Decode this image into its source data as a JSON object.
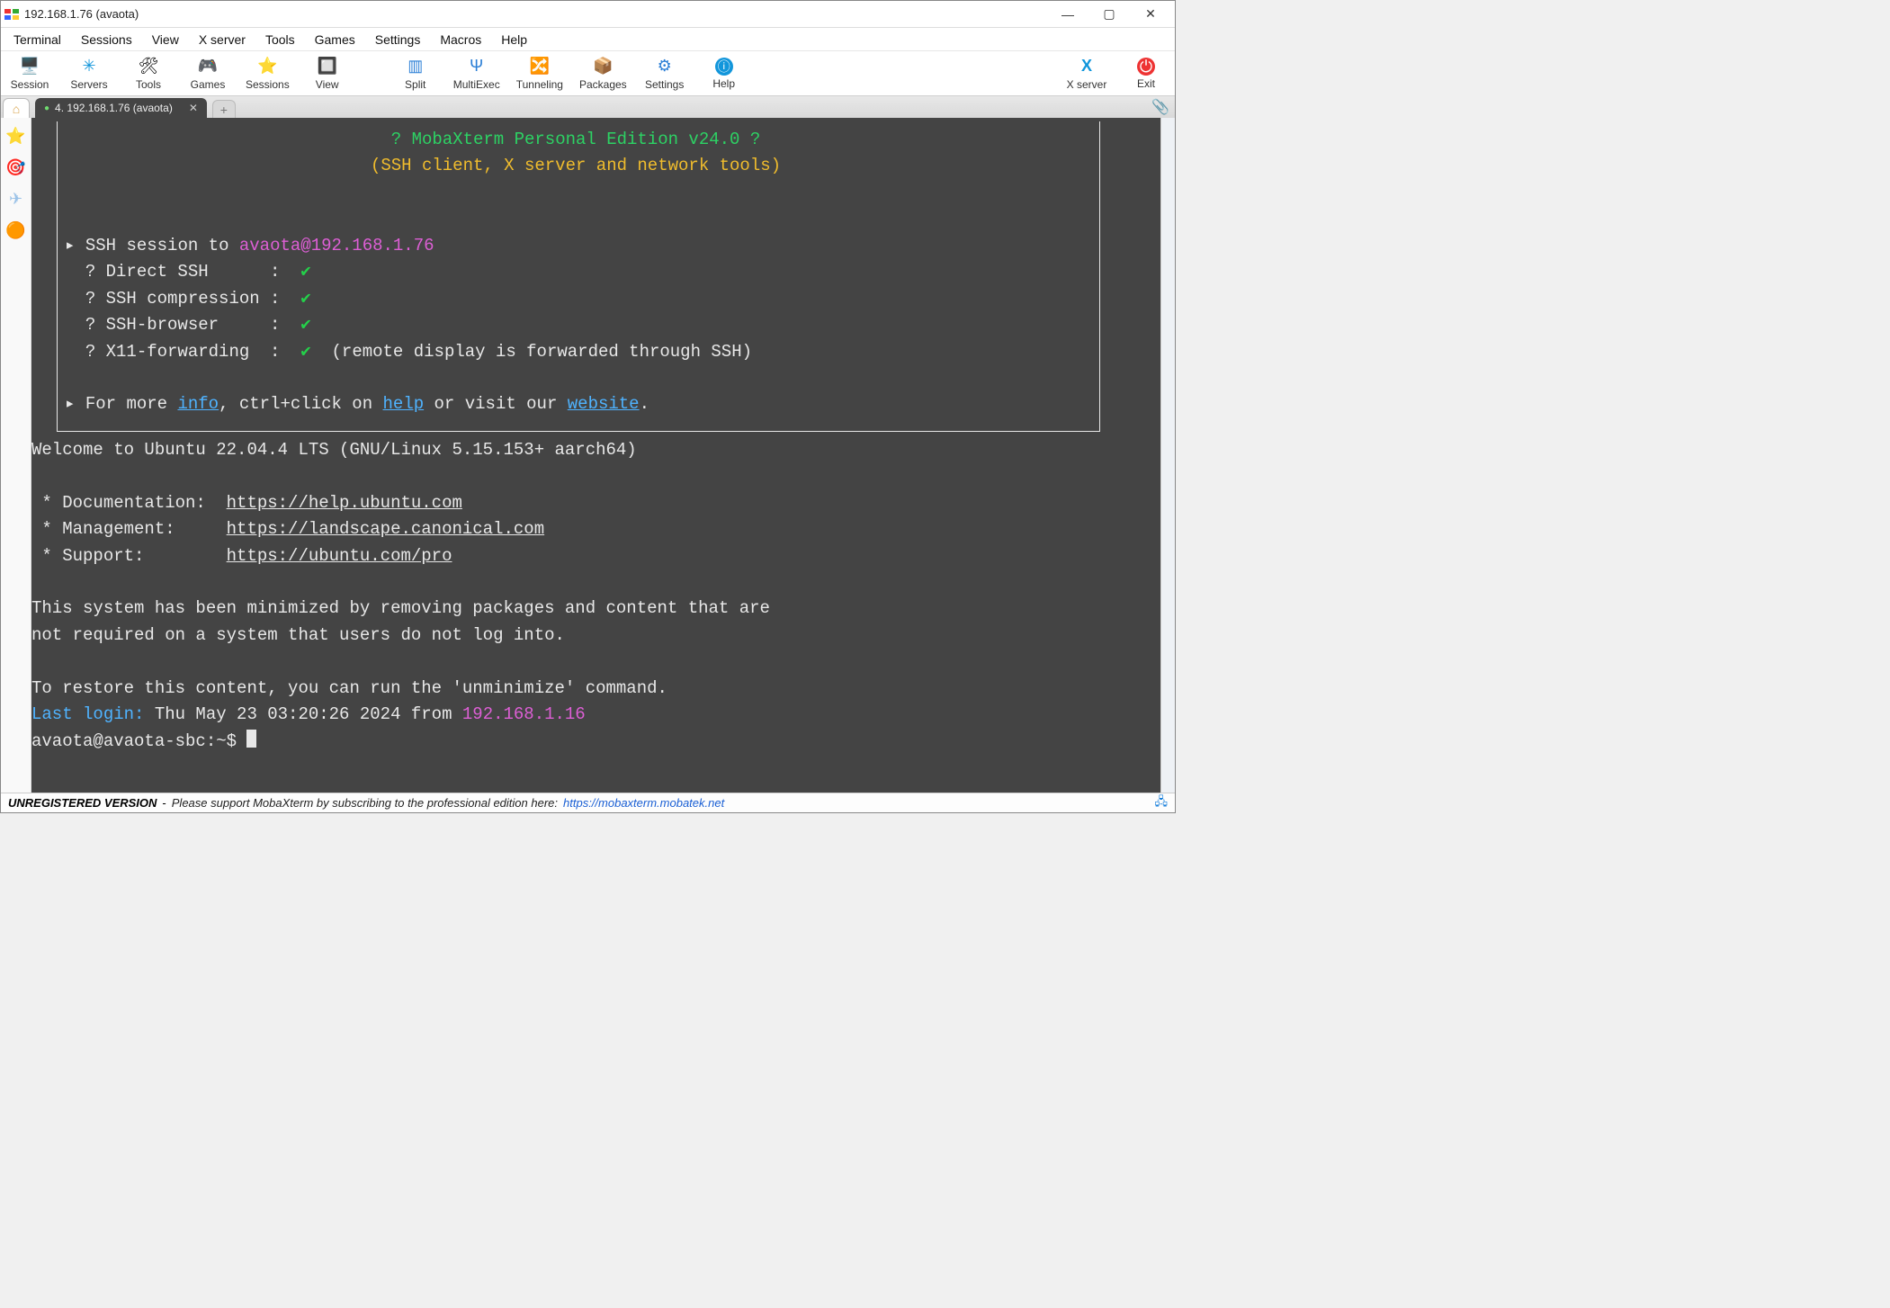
{
  "window": {
    "title": "192.168.1.76 (avaota)"
  },
  "menu": {
    "items": [
      "Terminal",
      "Sessions",
      "View",
      "X server",
      "Tools",
      "Games",
      "Settings",
      "Macros",
      "Help"
    ]
  },
  "toolbar": {
    "left": [
      {
        "label": "Session",
        "icon": "🖥️"
      },
      {
        "label": "Servers",
        "icon": "✳"
      },
      {
        "label": "Tools",
        "icon": "🛠"
      },
      {
        "label": "Games",
        "icon": "🎮"
      },
      {
        "label": "Sessions",
        "icon": "⭐"
      },
      {
        "label": "View",
        "icon": "🔲"
      },
      {
        "label": "Split",
        "icon": "▥"
      },
      {
        "label": "MultiExec",
        "icon": "Ψ"
      },
      {
        "label": "Tunneling",
        "icon": "🔀"
      },
      {
        "label": "Packages",
        "icon": "📦"
      },
      {
        "label": "Settings",
        "icon": "⚙"
      },
      {
        "label": "Help",
        "icon": "ⓘ"
      }
    ],
    "right": [
      {
        "label": "X server",
        "icon": "X"
      },
      {
        "label": "Exit",
        "icon": "⏻"
      }
    ]
  },
  "tabs": {
    "home_icon": "🏠",
    "session": "4. 192.168.1.76 (avaota)",
    "add": "+"
  },
  "sidebar": {
    "icons": [
      "⭐",
      "🎯",
      "✈",
      "🟠"
    ]
  },
  "terminal": {
    "banner_title": "? MobaXterm Personal Edition v24.0 ?",
    "banner_sub": "(SSH client, X server and network tools)",
    "ssh_session_prefix": "▸ SSH session to ",
    "ssh_target": "avaota@192.168.1.76",
    "lines_check": [
      "? Direct SSH      : ",
      "? SSH compression : ",
      "? SSH-browser     : ",
      "? X11-forwarding  : "
    ],
    "x11_note": "  (remote display is forwarded through SSH)",
    "more_prefix": "▸ For more ",
    "info": "info",
    "more_mid": ", ctrl+click on ",
    "help": "help",
    "more_mid2": " or visit our ",
    "website": "website",
    "dot": ".",
    "welcome": "Welcome to Ubuntu 22.04.4 LTS (GNU/Linux 5.15.153+ aarch64)",
    "doc_label": " * Documentation:  ",
    "doc_url": "https://help.ubuntu.com",
    "mgmt_label": " * Management:     ",
    "mgmt_url": "https://landscape.canonical.com",
    "sup_label": " * Support:        ",
    "sup_url": "https://ubuntu.com/pro",
    "minimize1": "This system has been minimized by removing packages and content that are",
    "minimize2": "not required on a system that users do not log into.",
    "restore": "To restore this content, you can run the 'unminimize' command.",
    "lastlogin_label": "Last login:",
    "lastlogin_rest": " Thu May 23 03:20:26 2024 from ",
    "lastlogin_ip": "192.168.1.16",
    "prompt": "avaota@avaota-sbc:~$ "
  },
  "statusbar": {
    "unreg": "UNREGISTERED VERSION",
    "dash": " - ",
    "msg": "Please support MobaXterm by subscribing to the professional edition here: ",
    "url": "https://mobaxterm.mobatek.net"
  }
}
